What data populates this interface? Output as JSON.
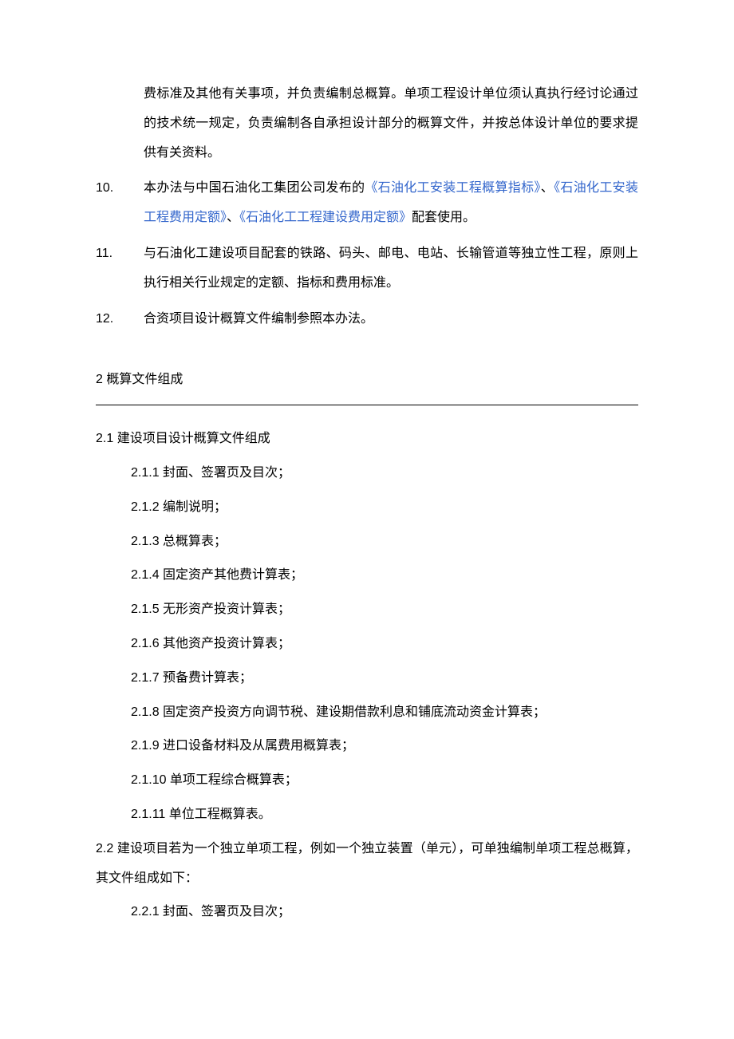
{
  "continuation_9": "费标准及其他有关事项，并负责编制总概算。单项工程设计单位须认真执行经讨论通过的技术统一规定，负责编制各自承担设计部分的概算文件，并按总体设计单位的要求提供有关资料。",
  "item10": {
    "num": "10.",
    "pre": "本办法与中国石油化工集团公司发布的",
    "link1": "《石油化工安装工程概算指标》",
    "sep1": "、",
    "link2": "《石油化工安装工程费用定额》",
    "sep2": "、",
    "link3": "《石油化工工程建设费用定额》",
    "post": "配套使用。"
  },
  "item11": {
    "num": "11.",
    "text": "与石油化工建设项目配套的铁路、码头、邮电、电站、长输管道等独立性工程，原则上执行相关行业规定的定额、指标和费用标准。"
  },
  "item12": {
    "num": "12.",
    "text": "合资项目设计概算文件编制参照本办法。"
  },
  "section2_heading": "2  概算文件组成",
  "section2_1": {
    "heading": "2.1  建设项目设计概算文件组成",
    "items": [
      "2.1.1  封面、签署页及目次；",
      "2.1.2  编制说明；",
      "2.1.3  总概算表；",
      "2.1.4  固定资产其他费计算表；",
      "2.1.5  无形资产投资计算表；",
      "2.1.6  其他资产投资计算表；",
      "2.1.7  预备费计算表；",
      "2.1.8  固定资产投资方向调节税、建设期借款利息和铺底流动资金计算表；",
      "2.1.9  进口设备材料及从属费用概算表；",
      "2.1.10  单项工程综合概算表；",
      "2.1.11  单位工程概算表。"
    ]
  },
  "section2_2": {
    "heading": "2.2  建设项目若为一个独立单项工程，例如一个独立装置（单元），可单独编制单项工程总概算，其文件组成如下：",
    "items": [
      "2.2.1  封面、签署页及目次；"
    ]
  }
}
